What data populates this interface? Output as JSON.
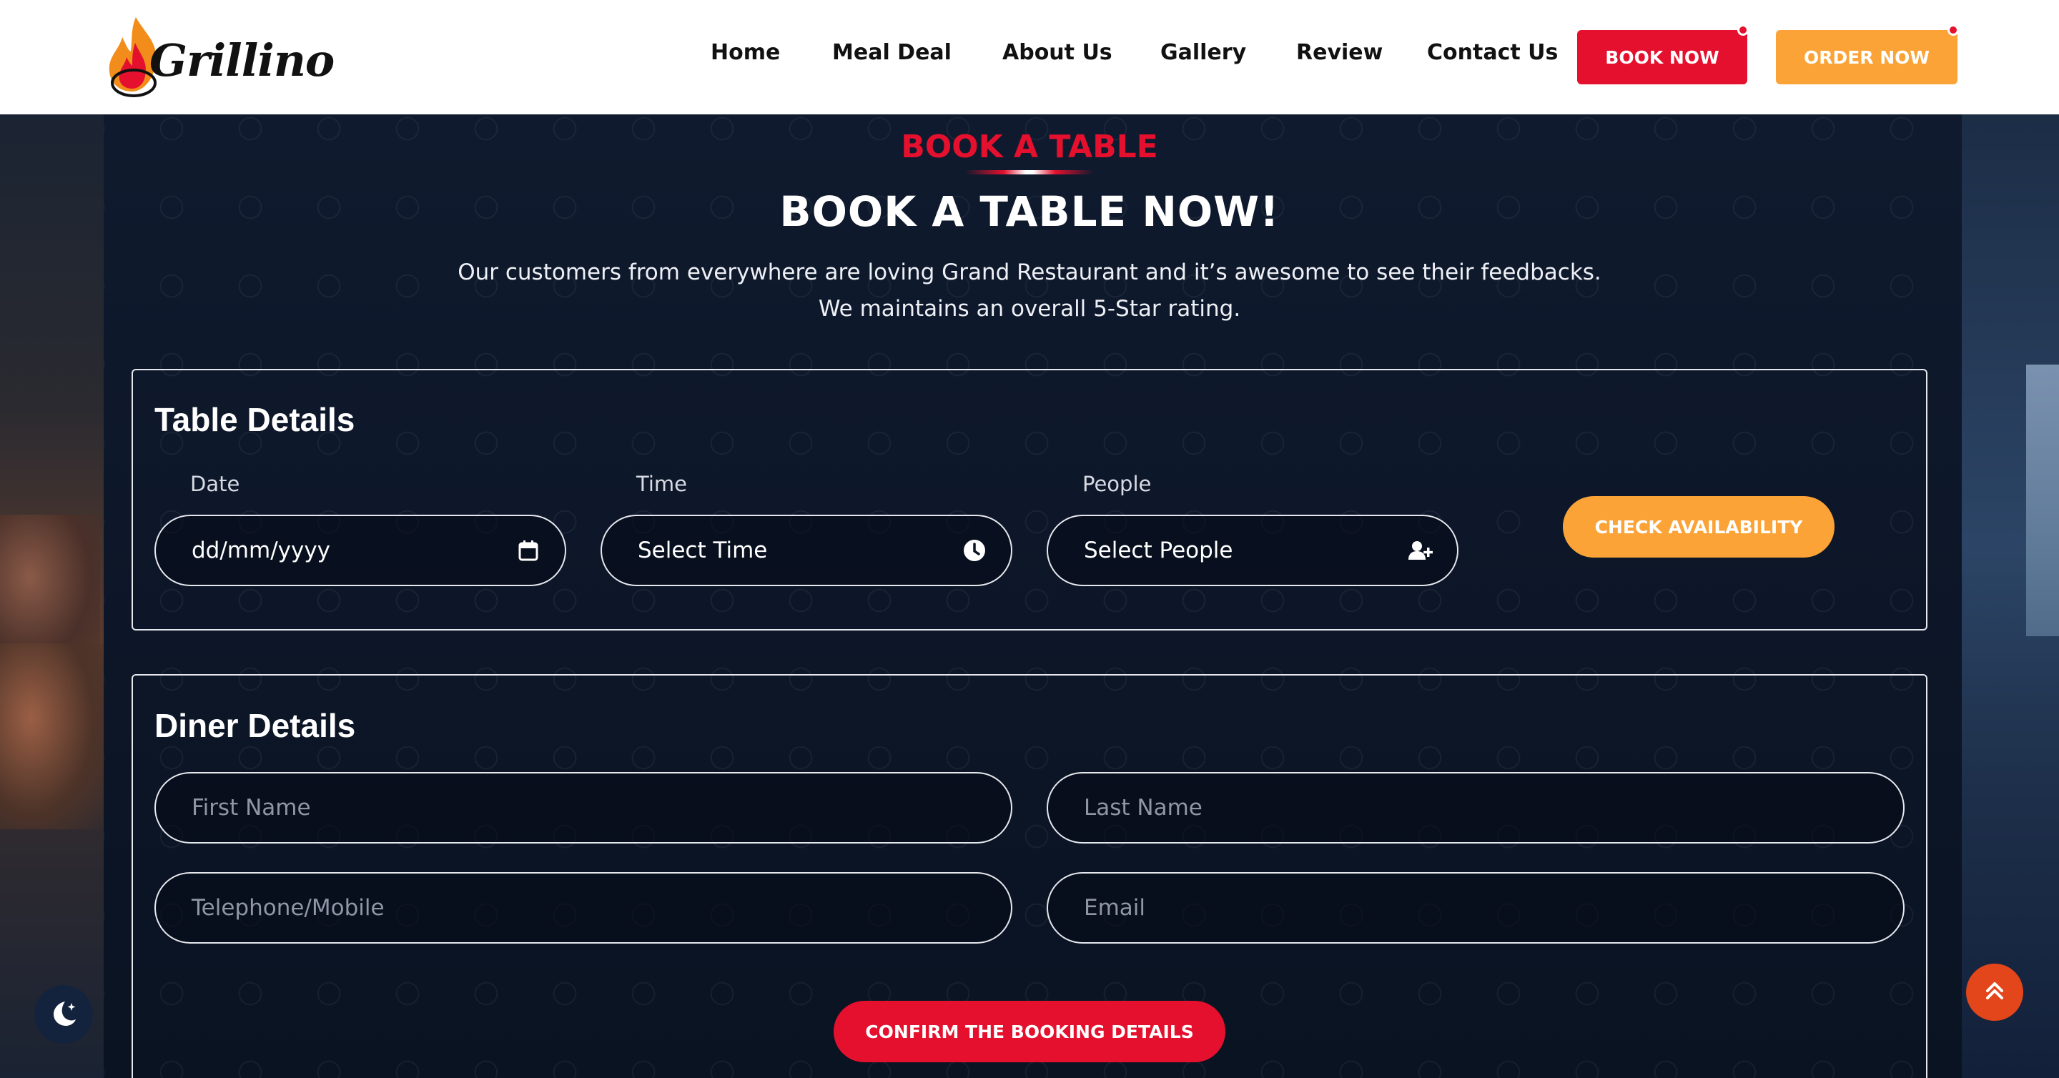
{
  "brand": {
    "name": "Grillino"
  },
  "nav": {
    "items": [
      "Home",
      "Meal Deal",
      "About Us",
      "Gallery",
      "Review",
      "Contact Us"
    ],
    "book_now": "BOOK NOW",
    "order_now": "ORDER NOW"
  },
  "section": {
    "eyebrow": "BOOK A TABLE",
    "title": "BOOK A TABLE NOW!",
    "desc_line1": "Our customers from everywhere are loving Grand Restaurant and it’s awesome to see their feedbacks.",
    "desc_line2": "We maintains an overall 5-Star rating."
  },
  "table_details": {
    "title": "Table Details",
    "date_label": "Date",
    "date_value": "dd/mm/yyyy",
    "time_label": "Time",
    "time_value": "Select Time",
    "people_label": "People",
    "people_value": "Select People",
    "check_button": "CHECK AVAILABILITY"
  },
  "diner_details": {
    "title": "Diner Details",
    "first_name_placeholder": "First Name",
    "last_name_placeholder": "Last Name",
    "phone_placeholder": "Telephone/Mobile",
    "email_placeholder": "Email",
    "confirm_button": "CONFIRM THE BOOKING DETAILS"
  },
  "colors": {
    "primary_red": "#e4102e",
    "accent_orange": "#fba336",
    "background": "#0b1424",
    "scroll_top": "#e2461a"
  },
  "icons": {
    "date": "calendar-icon",
    "time": "clock-icon",
    "people": "user-plus-icon",
    "theme": "moon-stars-icon",
    "scroll_top": "double-chevron-up-icon"
  }
}
